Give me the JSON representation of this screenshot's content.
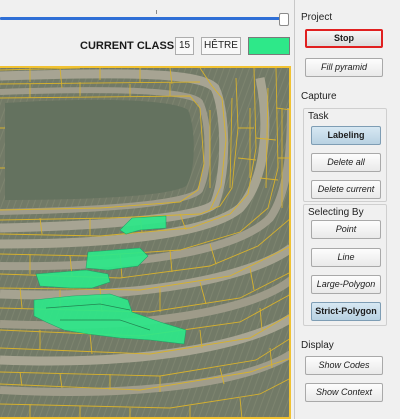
{
  "toolbar": {
    "current_class_label": "CURRENT CLASS:",
    "class_number": "15",
    "class_name": "HÊTRE",
    "class_color": "#2ee889"
  },
  "slider": {
    "value": 1.0
  },
  "panel": {
    "project_title": "Project",
    "stop_label": "Stop",
    "fill_pyramid_label": "Fill pyramid",
    "capture_title": "Capture",
    "task_title": "Task",
    "labeling_label": "Labeling",
    "delete_all_label": "Delete all",
    "delete_current_label": "Delete current",
    "selecting_by_title": "Selecting By",
    "point_label": "Point",
    "line_label": "Line",
    "large_polygon_label": "Large-Polygon",
    "strict_polygon_label": "Strict-Polygon",
    "display_title": "Display",
    "show_codes_label": "Show Codes",
    "show_context_label": "Show Context"
  },
  "colors": {
    "accent_border": "#f1c232",
    "stop_border": "#e02020",
    "label_fill": "#2ee889",
    "segment_lines": "#d6b12e",
    "slider_track": "#2f6fd6"
  }
}
